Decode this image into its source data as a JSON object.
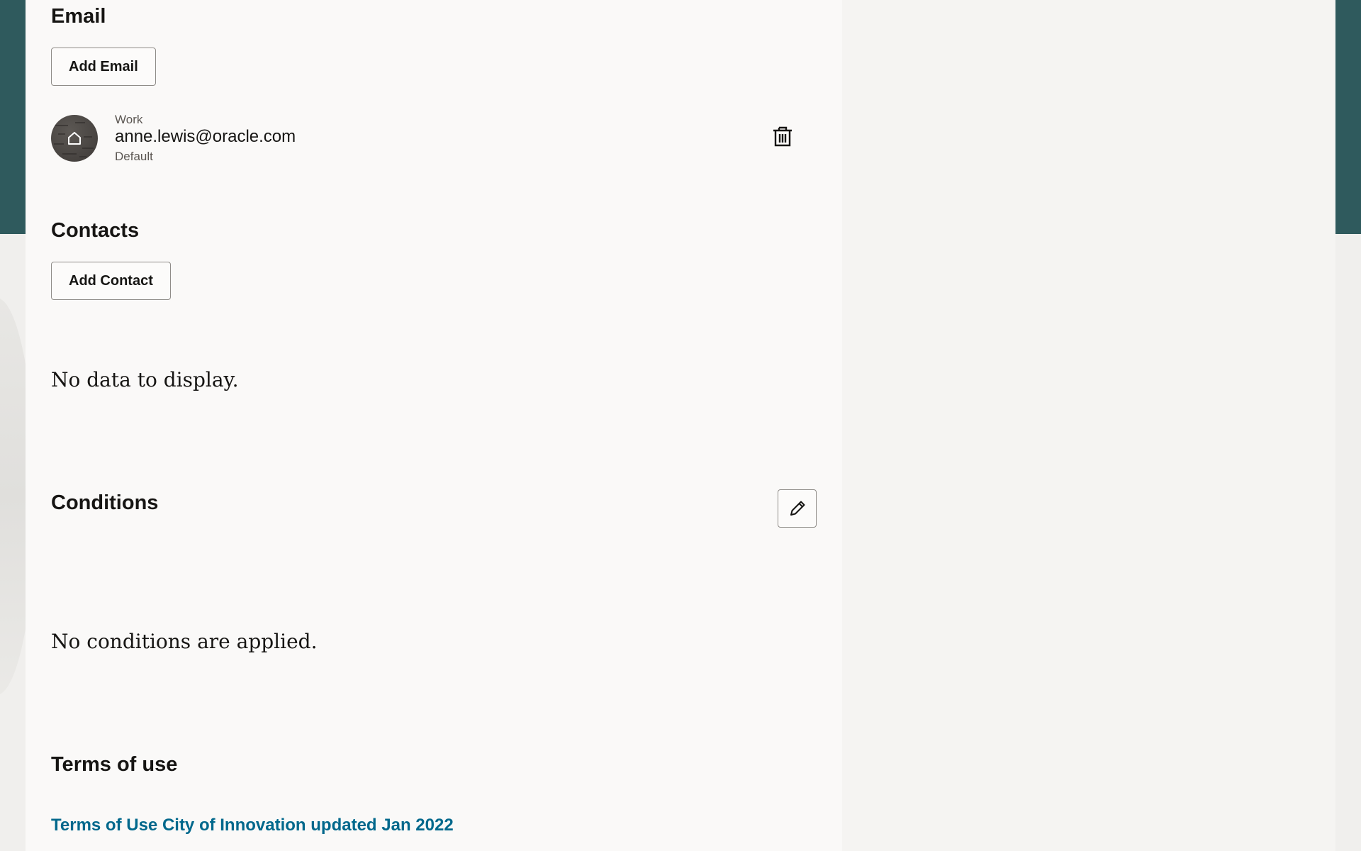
{
  "email_section": {
    "title": "Email",
    "add_button_label": "Add Email",
    "items": [
      {
        "type": "Work",
        "address": "anne.lewis@oracle.com",
        "status": "Default",
        "icon": "home-icon",
        "delete_icon": "trash-icon"
      }
    ]
  },
  "contacts_section": {
    "title": "Contacts",
    "add_button_label": "Add Contact",
    "empty_message": "No data to display."
  },
  "conditions_section": {
    "title": "Conditions",
    "edit_icon": "pencil-icon",
    "empty_message": "No conditions are applied."
  },
  "terms_section": {
    "title": "Terms of use",
    "link_text": "Terms of Use City of Innovation updated Jan 2022"
  },
  "colors": {
    "header_band": "#2f5a5d",
    "link": "#00688c",
    "text": "#161513"
  }
}
